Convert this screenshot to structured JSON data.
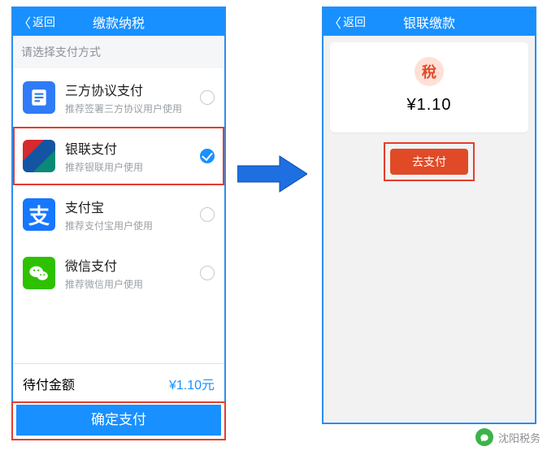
{
  "left": {
    "back_label": "返回",
    "title": "缴款纳税",
    "section_label": "请选择支付方式",
    "options": [
      {
        "name": "三方协议支付",
        "sub": "推荐签署三方协议用户使用",
        "selected": false
      },
      {
        "name": "银联支付",
        "sub": "推荐银联用户使用",
        "selected": true
      },
      {
        "name": "支付宝",
        "sub": "推荐支付宝用户使用",
        "selected": false
      },
      {
        "name": "微信支付",
        "sub": "推荐微信用户使用",
        "selected": false
      }
    ],
    "amount_label": "待付金额",
    "amount_value": "¥1.10元",
    "confirm_label": "确定支付"
  },
  "right": {
    "back_label": "返回",
    "title": "银联缴款",
    "stamp_glyph": "稅",
    "price": "¥1.10",
    "pay_label": "去支付"
  },
  "watermark": "沈阳税务"
}
